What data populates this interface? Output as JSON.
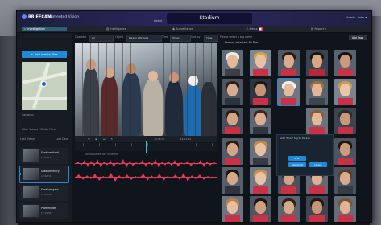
{
  "header": {
    "brand": "BRIEFCAM",
    "app_name": "Augmented Vision",
    "home_label": "Home",
    "site_title": "Stadium",
    "right_label": "Admin",
    "user_label": "John"
  },
  "tabs": [
    {
      "label": "Investigation"
    },
    {
      "label": "Intelligence"
    },
    {
      "label": "Surveillance"
    },
    {
      "label": "Alerts"
    },
    {
      "label": "Report"
    }
  ],
  "sidebar": {
    "add_button": "Add media files",
    "cameras_label": "Cameras",
    "filter_label": "Filter Videos / Media Files",
    "list_header_left": "Last Videos",
    "list_header_right": "Last Case",
    "feeds": [
      {
        "name": "Stadium front",
        "meta": "12:04:11"
      },
      {
        "name": "Stadium entry",
        "meta": "12:06:31"
      },
      {
        "name": "Stadium gate",
        "meta": "12:11:08"
      },
      {
        "name": "Promenade",
        "meta": "12:14:52"
      }
    ]
  },
  "filters": {
    "operator_label": "Operator",
    "operator_value": "All",
    "type_label": "Object",
    "type_value": "Person Attribute",
    "time_label": "Time",
    "time_value": "Today",
    "sort_label": "Sort by",
    "sort_value": "Time"
  },
  "player": {
    "time_left": "12:06:31",
    "time_right": "12:11:20",
    "audio_title": "Sound Detection Timeline"
  },
  "gallery": {
    "select_label": "Please select a tag name",
    "subtitle": "Persons detected: 98 Files",
    "add_tags": "Add Tags",
    "popup_title": "Add 'Scarf' tag to Person",
    "popup_buttons": [
      "Scarf",
      "Backpack",
      "Jersey"
    ]
  },
  "colors": {
    "accent": "#1e8bd8",
    "waveform": "#e8365a",
    "playhead": "#22c6f0",
    "topbar": "#2a2860"
  }
}
